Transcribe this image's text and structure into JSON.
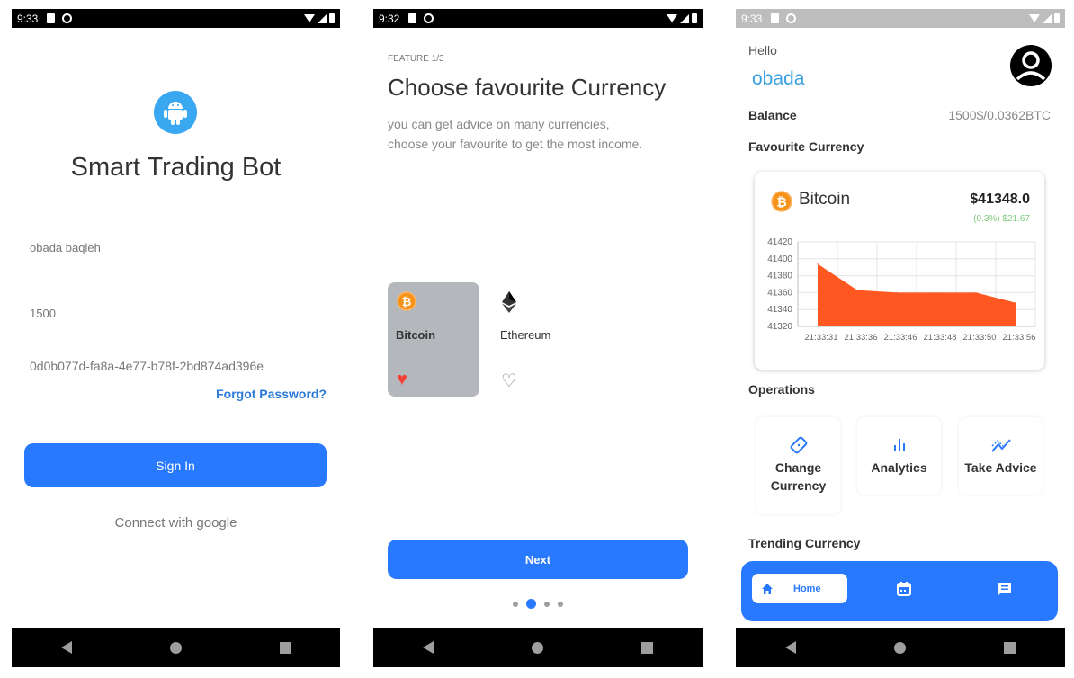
{
  "screens": {
    "login": {
      "status_time": "9:33",
      "app_title": "Smart Trading Bot",
      "username_value": "obada baqleh",
      "amount_value": "1500",
      "key_value": "0d0b077d-fa8a-4e77-b78f-2bd874ad396e",
      "forgot_password": "Forgot Password?",
      "sign_in": "Sign In",
      "connect_google": "Connect with google"
    },
    "onboarding": {
      "status_time": "9:32",
      "feature_label": "FEATURE 1/3",
      "title": "Choose favourite Currency",
      "subtitle_line1": "you can get advice on many currencies,",
      "subtitle_line2": "choose your favourite to get the most income.",
      "currencies": [
        {
          "name": "Bitcoin",
          "icon": "bitcoin-icon",
          "favourite": true,
          "selected": true
        },
        {
          "name": "Ethereum",
          "icon": "ethereum-icon",
          "favourite": false,
          "selected": false
        }
      ],
      "next": "Next",
      "page_dots": {
        "count": 4,
        "active_index": 1
      }
    },
    "home": {
      "status_time": "9:33",
      "greeting": "Hello",
      "user_name": "obada",
      "balance_label": "Balance",
      "balance_value": "1500$/0.0362BTC",
      "favourite_section": "Favourite Currency",
      "fav_currency_name": "Bitcoin",
      "fav_price": "$41348.0",
      "fav_change": "(0.3%) $21.67",
      "operations_section": "Operations",
      "operations": [
        {
          "label_line1": "Change",
          "label_line2": "Currency",
          "icon": "ticket-icon"
        },
        {
          "label_line1": "Analytics",
          "label_line2": "",
          "icon": "bar-chart-icon"
        },
        {
          "label_line1": "Take Advice",
          "label_line2": "",
          "icon": "trend-icon"
        }
      ],
      "trending_section": "Trending Currency",
      "bottom_nav": {
        "home": "Home"
      }
    }
  },
  "colors": {
    "primary": "#2979ff",
    "chart_fill": "#ff5722",
    "bitcoin": "#f7931a",
    "heart": "#f44336",
    "positive": "#7ecb7e"
  },
  "chart_data": {
    "type": "area",
    "title": "",
    "xlabel": "",
    "ylabel": "",
    "categories": [
      "21:33:31",
      "21:33:36",
      "21:33:46",
      "21:33:48",
      "21:33:50",
      "21:33:56"
    ],
    "values": [
      41394,
      41363,
      41360,
      41360,
      41360,
      41348
    ],
    "ylim": [
      41320,
      41420
    ],
    "yticks": [
      41320,
      41340,
      41360,
      41380,
      41400,
      41420
    ],
    "grid": true,
    "legend": "none"
  }
}
